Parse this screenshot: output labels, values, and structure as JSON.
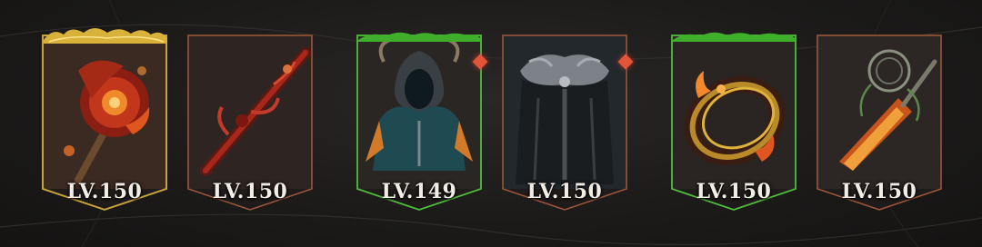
{
  "equipment": [
    {
      "level_label": "LV.150",
      "item": "flame-axe",
      "frame": "gold-crown",
      "accent": "#c8a23a",
      "badge": false
    },
    {
      "level_label": "LV.150",
      "item": "crimson-rifle",
      "frame": "plain",
      "accent": "#8a4a32",
      "badge": false
    },
    {
      "level_label": "LV.149",
      "item": "hooded-mantle",
      "frame": "green-crown",
      "accent": "#4fbf3a",
      "badge": true
    },
    {
      "level_label": "LV.150",
      "item": "fur-cloak",
      "frame": "plain",
      "accent": "#8a4a32",
      "badge": true
    },
    {
      "level_label": "LV.150",
      "item": "ember-ring",
      "frame": "green-crown",
      "accent": "#4fbf3a",
      "badge": false
    },
    {
      "level_label": "LV.150",
      "item": "vine-dagger",
      "frame": "plain",
      "accent": "#8a4a32",
      "badge": false
    }
  ],
  "colors": {
    "badge": "#e2553a",
    "level_text": "#f1ece4",
    "card_border": "#a0583a"
  }
}
